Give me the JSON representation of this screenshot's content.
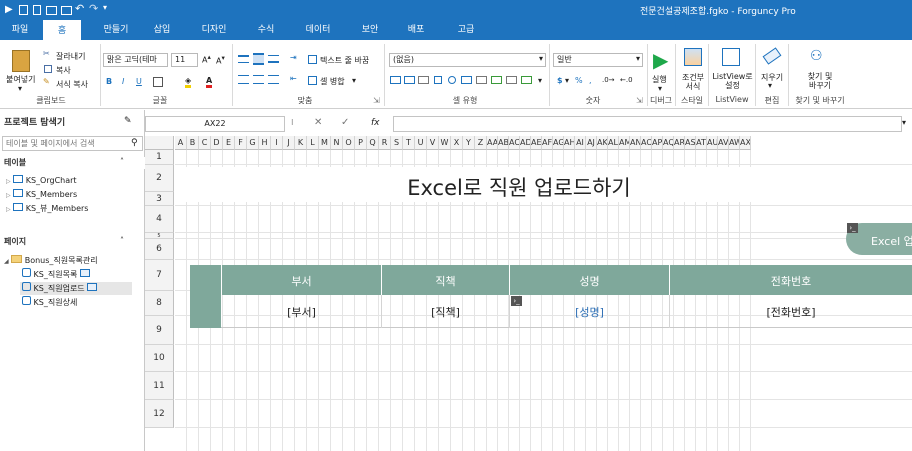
{
  "window": {
    "title": "전문건설공제조합.fgko - Forguncy Pro"
  },
  "tabs": [
    "파일",
    "홈",
    "만들기",
    "삽입",
    "디자인",
    "수식",
    "데이터",
    "보안",
    "배포",
    "고급"
  ],
  "active_tab": "홈",
  "ribbon": {
    "clipboard": {
      "paste": "붙여넣기",
      "cut": "잘라내기",
      "copy": "복사",
      "format_painter": "서식 복사",
      "label": "클립보드"
    },
    "font": {
      "family": "맑은 고딕(테마",
      "size": "11",
      "label": "글꼴"
    },
    "align": {
      "wrap_text": "텍스트 줄 바꿈",
      "merge": "셀 병합",
      "label": "맞춤"
    },
    "cell_type": {
      "value": "(없음)",
      "label": "셀 유형"
    },
    "number": {
      "format": "일반",
      "label": "숫자"
    },
    "run": {
      "label": "실행",
      "group": "디버그"
    },
    "cond_format": {
      "label": "조건부 서식",
      "group": "스타일"
    },
    "listview": {
      "label": "ListView로 설정",
      "group": "ListView"
    },
    "clear": {
      "label": "지우기",
      "group": "편집"
    },
    "find": {
      "label": "찾기 및 바꾸기",
      "group": "찾기 및 바꾸기"
    }
  },
  "project_explorer": {
    "title": "프로젝트 탐색기",
    "search_placeholder": "테이블 및 페이지에서 검색",
    "tables_header": "테이블",
    "tables": [
      "KS_OrgChart",
      "KS_Members",
      "KS_뷰_Members"
    ],
    "pages_header": "페이지",
    "folder": "Bonus_직원목록관리",
    "pages": [
      "KS_직원목록",
      "KS_직원업로드",
      "KS_직원상세"
    ]
  },
  "formula_bar": {
    "name_box": "AX22",
    "fx": "fx",
    "value": ""
  },
  "columns": [
    "A",
    "B",
    "C",
    "D",
    "E",
    "F",
    "G",
    "H",
    "I",
    "J",
    "K",
    "L",
    "M",
    "N",
    "O",
    "P",
    "Q",
    "R",
    "S",
    "T",
    "U",
    "V",
    "W",
    "X",
    "Y",
    "Z",
    "AA",
    "AB",
    "AC",
    "AD",
    "AE",
    "AF",
    "AG",
    "AH",
    "AI",
    "AJ",
    "AK",
    "AL",
    "AM",
    "AN",
    "AO",
    "AP",
    "AQ",
    "AR",
    "AS",
    "AT",
    "AU",
    "AV",
    "AW",
    "AX"
  ],
  "rows": [
    "1",
    "2",
    "3",
    "4",
    "5",
    "6",
    "7",
    "8",
    "9",
    "10",
    "11",
    "12"
  ],
  "sheet": {
    "title": "Excel로 직원 업로드하기",
    "button_label": "Excel 업",
    "headers": [
      "부서",
      "직책",
      "성명",
      "전화번호"
    ],
    "values": [
      "[부서]",
      "[직책]",
      "[성명]",
      "[전화번호]"
    ],
    "header_color": "#7fa89b",
    "link_color": "#2e6fb5"
  },
  "colors": {
    "accent": "#1e73be",
    "run": "#1ea84a"
  }
}
